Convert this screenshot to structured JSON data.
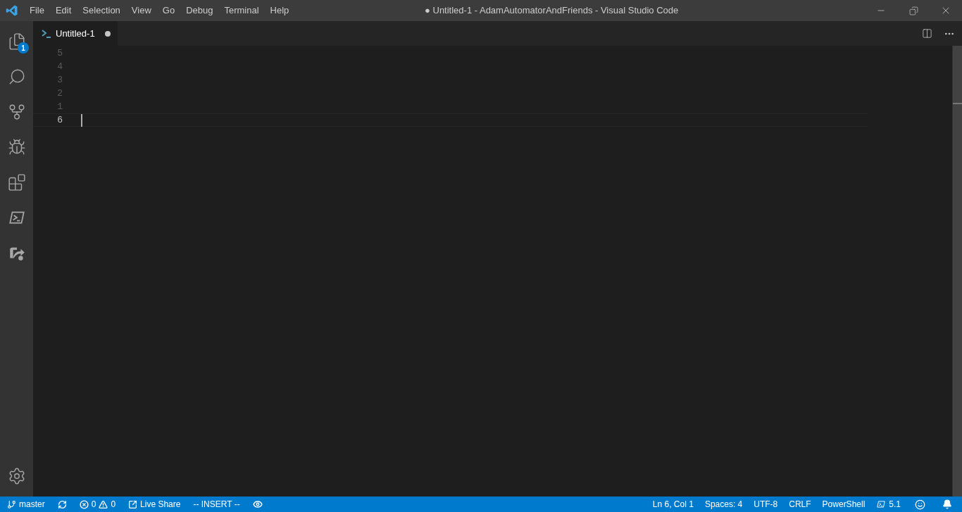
{
  "window": {
    "title": "● Untitled-1 - AdamAutomatorAndFriends - Visual Studio Code"
  },
  "menu": [
    "File",
    "Edit",
    "Selection",
    "View",
    "Go",
    "Debug",
    "Terminal",
    "Help"
  ],
  "activity_bar": {
    "items": [
      {
        "kind": "explorer",
        "badge": "1"
      },
      {
        "kind": "search"
      },
      {
        "kind": "source-control"
      },
      {
        "kind": "debug"
      },
      {
        "kind": "extensions"
      },
      {
        "kind": "powershell"
      },
      {
        "kind": "live-share"
      }
    ],
    "bottom": [
      {
        "kind": "settings"
      }
    ]
  },
  "tabs": [
    {
      "label": "Untitled-1",
      "selected": true,
      "dirty": true
    }
  ],
  "editor": {
    "lines": [
      {
        "number": "5",
        "current": false
      },
      {
        "number": "4",
        "current": false
      },
      {
        "number": "3",
        "current": false
      },
      {
        "number": "2",
        "current": false
      },
      {
        "number": "1",
        "current": false
      },
      {
        "number": "6",
        "current": true
      }
    ]
  },
  "status_bar": {
    "left": [
      {
        "kind": "branch",
        "text": "master"
      },
      {
        "kind": "sync"
      },
      {
        "kind": "problems",
        "errors": "0",
        "warnings": "0"
      },
      {
        "kind": "live-share",
        "text": "Live Share"
      },
      {
        "kind": "text",
        "text": "-- INSERT --"
      },
      {
        "kind": "eye"
      }
    ],
    "right": [
      {
        "kind": "text",
        "text": "Ln 6, Col 1"
      },
      {
        "kind": "text",
        "text": "Spaces: 4"
      },
      {
        "kind": "text",
        "text": "UTF-8"
      },
      {
        "kind": "text",
        "text": "CRLF"
      },
      {
        "kind": "text",
        "text": "PowerShell"
      },
      {
        "kind": "ps-version",
        "text": "5.1"
      },
      {
        "kind": "smiley"
      },
      {
        "kind": "bell"
      }
    ]
  }
}
